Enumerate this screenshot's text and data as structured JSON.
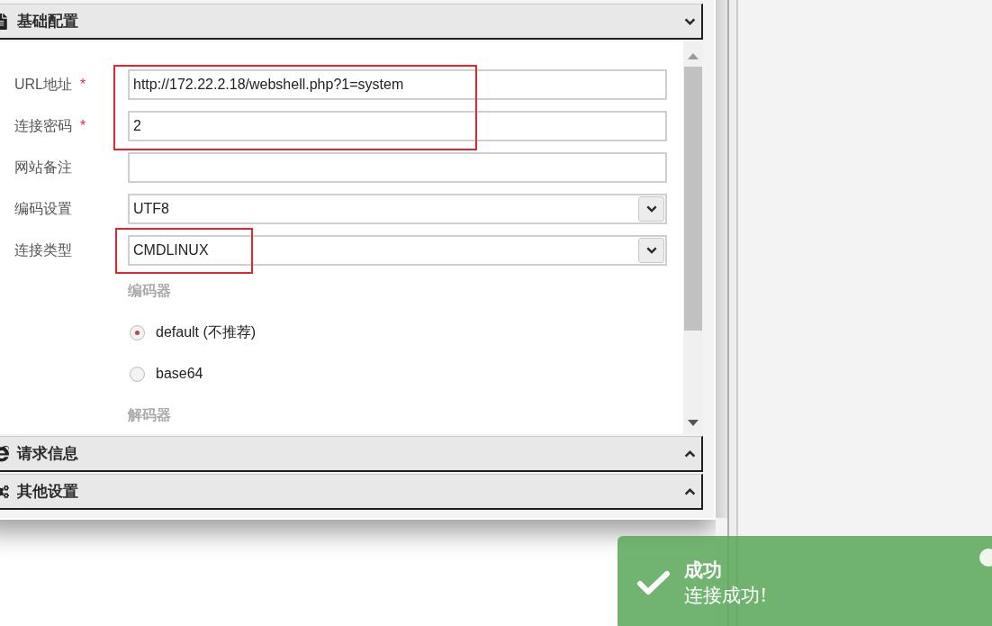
{
  "sections": [
    {
      "title": "基础配置",
      "expanded": true,
      "fields": [
        {
          "kind": "text",
          "label": "URL地址",
          "required_mark": "*",
          "value": "http://172.22.2.18/webshell.php?1=system"
        },
        {
          "kind": "text",
          "label": "连接密码",
          "required_mark": "*",
          "value": "2"
        },
        {
          "kind": "text",
          "label": "网站备注"
        },
        {
          "kind": "select",
          "label": "编码设置",
          "value": "UTF8"
        },
        {
          "kind": "select",
          "label": "连接类型",
          "value": "CMDLINUX"
        }
      ],
      "groups": [
        {
          "title": "编码器",
          "options": [
            {
              "label": "default (不推荐)",
              "selected": true
            },
            {
              "label": "base64",
              "selected": false
            }
          ]
        },
        {
          "title": "解码器"
        }
      ]
    },
    {
      "title": "请求信息",
      "expanded": false
    },
    {
      "title": "其他设置",
      "expanded": false
    }
  ],
  "toast": {
    "title": "成功",
    "message": "连接成功!"
  }
}
